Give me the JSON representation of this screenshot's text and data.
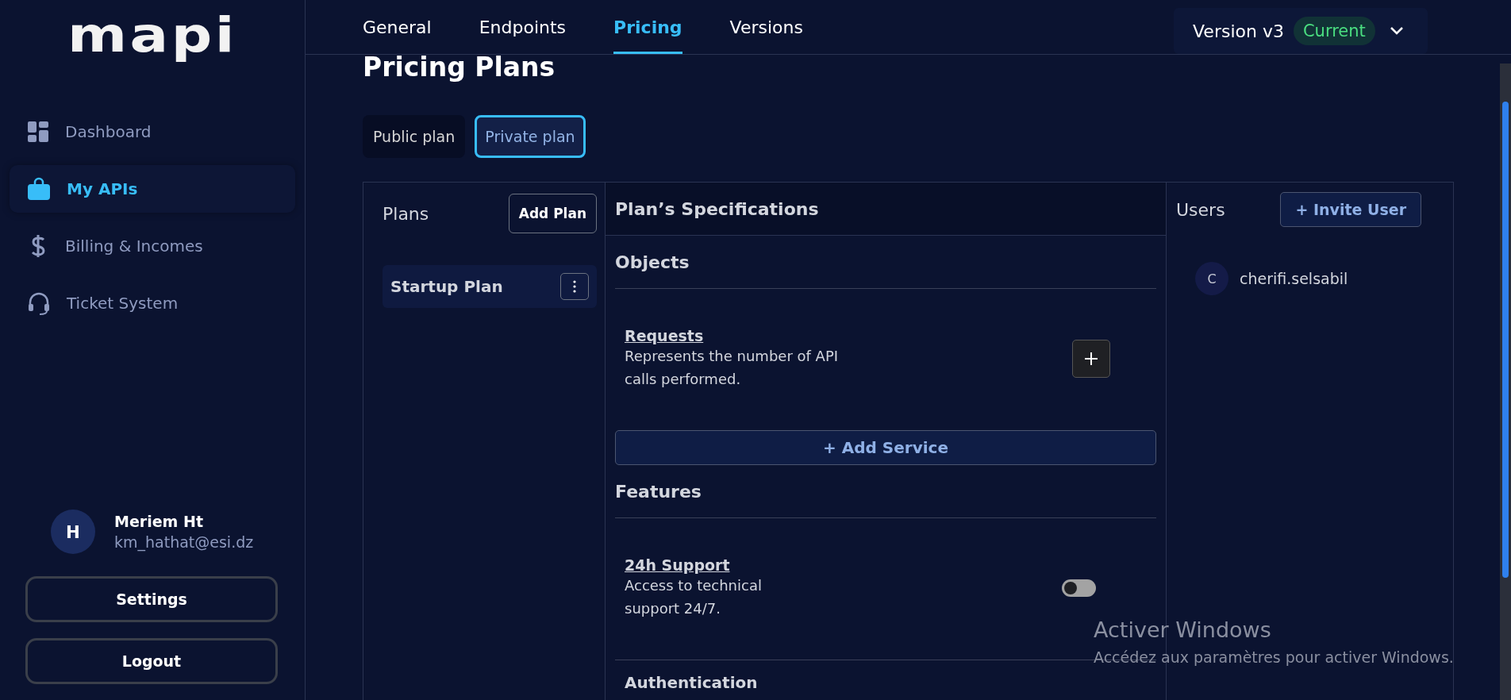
{
  "logo": "mapi",
  "nav": [
    {
      "label": "Dashboard",
      "kind": "grid",
      "selected": false
    },
    {
      "label": "My APIs",
      "kind": "bag",
      "selected": true
    },
    {
      "label": "Billing & Incomes",
      "kind": "dollar",
      "selected": false
    },
    {
      "label": "Ticket System",
      "kind": "headset",
      "selected": false
    }
  ],
  "user": {
    "initial": "H",
    "name": "Meriem Ht",
    "email": "km_hathat@esi.dz"
  },
  "sidebar_buttons": [
    "Settings",
    "Logout"
  ],
  "tabs": [
    {
      "label": "General",
      "selected": false
    },
    {
      "label": "Endpoints",
      "selected": false
    },
    {
      "label": "Pricing",
      "selected": true
    },
    {
      "label": "Versions",
      "selected": false
    }
  ],
  "version": {
    "label": "Version v3",
    "badge": "Current"
  },
  "title": "Pricing Plans",
  "plan_types": [
    {
      "label": "Public plan",
      "selected": false
    },
    {
      "label": "Private plan",
      "selected": true
    }
  ],
  "plans": {
    "title": "Plans",
    "add_button": "Add Plan",
    "items": [
      {
        "name": "Startup Plan",
        "selected": true
      }
    ]
  },
  "specs": {
    "title": "Plan’s Specifications",
    "sections": [
      {
        "heading": "Objects",
        "items": [
          {
            "kind": "object",
            "name": "Requests",
            "description": "Represents the number of API calls performed."
          }
        ],
        "add_button": "+ Add Service"
      },
      {
        "heading": "Features",
        "items": [
          {
            "kind": "feature",
            "name": "24h Support",
            "description": "Access to technical support 24/7.",
            "on": false
          }
        ]
      }
    ],
    "next_heading": "Authentication"
  },
  "users": {
    "title": "Users",
    "invite_button": "+ Invite User",
    "items": [
      {
        "initial": "C",
        "name": "cherifi.selsabil"
      }
    ]
  },
  "os_notice": {
    "title": "Activer Windows",
    "text": "Accédez aux paramètres pour activer Windows."
  }
}
